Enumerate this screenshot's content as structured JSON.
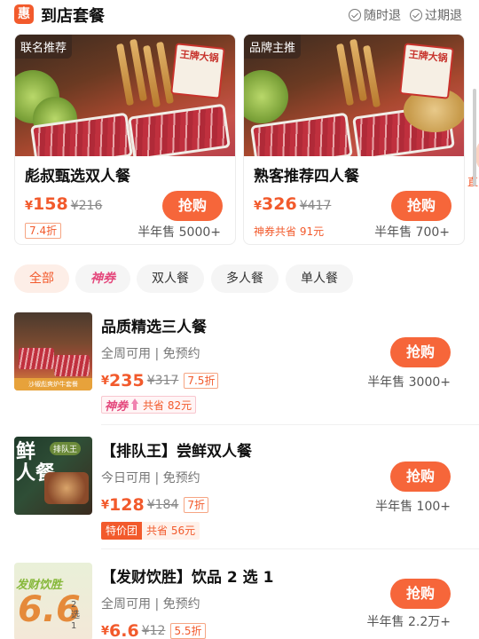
{
  "header": {
    "badge": "惠",
    "title": "到店套餐",
    "guarantees": [
      "随时退",
      "过期退"
    ]
  },
  "top_cards": [
    {
      "tag": "联名推荐",
      "name": "彪叔甄选双人餐",
      "currency": "¥",
      "price": "158",
      "original_price": "¥216",
      "discount": "7.4折",
      "buy_label": "抢购",
      "sold": "半年售 5000+",
      "sign_text": "王牌大锅"
    },
    {
      "tag": "品牌主推",
      "name": "熟客推荐四人餐",
      "currency": "¥",
      "price": "326",
      "original_price": "¥417",
      "savings": "神券共省 91元",
      "buy_label": "抢购",
      "sold": "半年售 700+",
      "sign_text": "王牌大锅"
    }
  ],
  "side_peek_text": "直",
  "filters": [
    {
      "label": "全部",
      "active": true
    },
    {
      "label": "神券",
      "active": false
    },
    {
      "label": "双人餐",
      "active": false
    },
    {
      "label": "多人餐",
      "active": false
    },
    {
      "label": "单人餐",
      "active": false
    }
  ],
  "items": [
    {
      "title": "品质精选三人餐",
      "sub": "全周可用 | 免预约",
      "currency": "¥",
      "price": "235",
      "original_price": "¥317",
      "discount": "7.5折",
      "promo_brand": "神券",
      "promo_save": "共省 82元",
      "buy_label": "抢购",
      "sold": "半年售 3000+",
      "thumb_text": "沙椒彪爽炉牛套餐"
    },
    {
      "title": "【排队王】尝鲜双人餐",
      "sub": "今日可用 | 免预约",
      "currency": "¥",
      "price": "128",
      "original_price": "¥184",
      "discount": "7折",
      "promo_brand": "特价团",
      "promo_save": "共省 56元",
      "buy_label": "抢购",
      "sold": "半年售 100+",
      "thumb_big": "鲜\n人餐",
      "thumb_label": "排队王"
    },
    {
      "title": "【发财饮胜】饮品 2 选 1",
      "sub": "全周可用 | 免预约",
      "currency": "¥",
      "price": "6.6",
      "original_price": "¥12",
      "discount": "5.5折",
      "buy_label": "抢购",
      "sold": "半年售 2.2万+",
      "thumb_top": "发财饮胜",
      "thumb_big": "6.6",
      "thumb_side": "2选1"
    }
  ]
}
